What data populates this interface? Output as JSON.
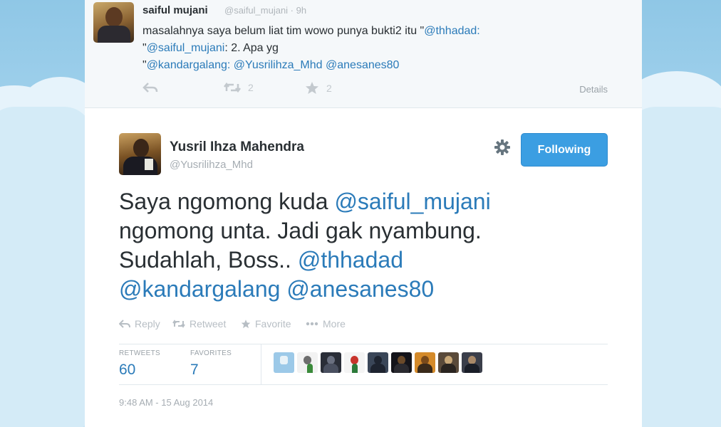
{
  "colors": {
    "link": "#2b7bb9",
    "follow_button": "#3b9ee2",
    "sky": "#a9d6ef"
  },
  "reply_tweet": {
    "name": "saiful mujani",
    "handle": "@saiful_mujani · 9h",
    "text_line1": "masalahnya saya belum liat tim wowo punya bukti2 itu \"",
    "mention_thhadad": "@thhadad:",
    "text_line2_prefix": "\"",
    "mention_saiful": "@saiful_mujani",
    "text_line2_rest": ": 2. Apa yg",
    "text_line3_prefix": "\"",
    "mention_kandargalang": "@kandargalang:",
    "mention_yusril": "@Yusrilihza_Mhd",
    "mention_anesanes": "@anesanes80",
    "retweet_count": "2",
    "favorite_count": "2",
    "details_label": "Details",
    "icons": [
      "reply-icon",
      "retweet-icon",
      "favorite-star-icon"
    ]
  },
  "main_tweet": {
    "name": "Yusril Ihza Mahendra",
    "handle": "@Yusrilihza_Mhd",
    "follow_label": "Following",
    "text_part1": "Saya ngomong kuda ",
    "mention_saiful": "@saiful_mujani",
    "text_part2": "ngomong unta. Jadi gak nyambung.",
    "text_part3": "Sudahlah, Boss.. ",
    "mention_thhadad": "@thhadad",
    "mention_kandargalang": "@kandargalang",
    "mention_anesanes": "@anesanes80",
    "actions": {
      "reply": "Reply",
      "retweet": "Retweet",
      "favorite": "Favorite",
      "more": "More"
    },
    "stats": {
      "retweets_label": "RETWEETS",
      "retweets_value": "60",
      "favorites_label": "FAVORITES",
      "favorites_value": "7"
    },
    "timestamp": "9:48 AM - 15 Aug 2014",
    "icons": [
      "gear-icon",
      "reply-icon",
      "retweet-icon",
      "favorite-star-icon",
      "more-dots-icon"
    ]
  }
}
